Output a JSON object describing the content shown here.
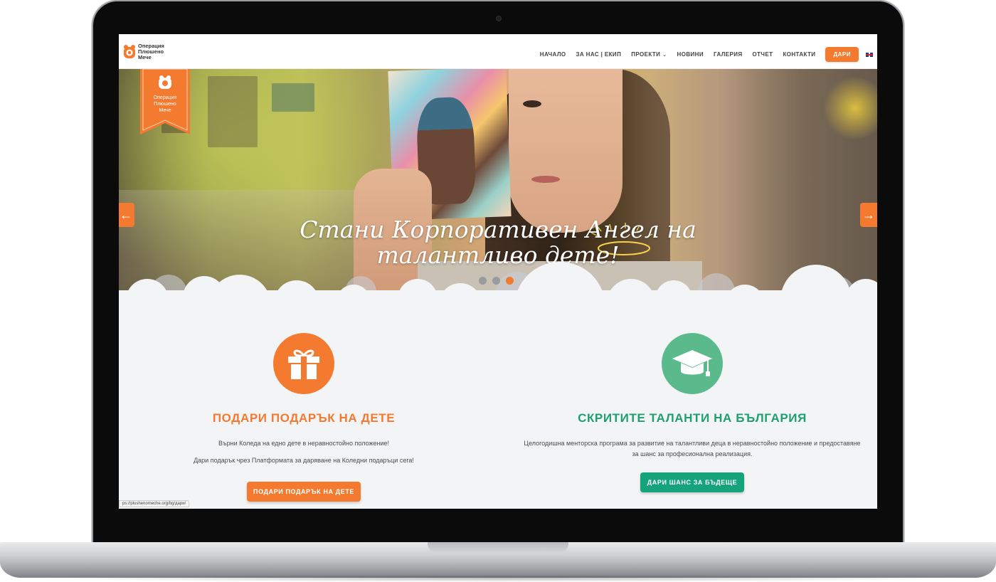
{
  "header": {
    "logo": {
      "line1": "Операция",
      "line2": "Плюшено",
      "line3": "Мече"
    },
    "nav": [
      {
        "label": "НАЧАЛО"
      },
      {
        "label": "ЗА НАС | ЕКИП"
      },
      {
        "label": "ПРОЕКТИ",
        "has_dropdown": true
      },
      {
        "label": "НОВИНИ"
      },
      {
        "label": "ГАЛЕРИЯ"
      },
      {
        "label": "ОТЧЕТ"
      },
      {
        "label": "КОНТАКТИ"
      }
    ],
    "donate_label": "ДАРИ",
    "language_icon": "uk-flag-icon"
  },
  "hero": {
    "title_line1": "Стани Корпоративен Ангел на",
    "title_line2": "талантливо дете!",
    "slides_count": 3,
    "active_slide": 3,
    "ribbon_logo": {
      "line1": "Операция",
      "line2": "Плюшено",
      "line3": "Мече"
    }
  },
  "features": [
    {
      "icon": "gift-icon",
      "title": "ПОДАРИ ПОДАРЪК НА ДЕТЕ",
      "text1": "Върни Коледа на едно дете в неравностойно положение!",
      "text2": "Дари подарък чрез Платформата за даряване на Коледни подаръци сега!",
      "button": "ПОДАРИ ПОДАРЪК НА ДЕТЕ"
    },
    {
      "icon": "graduation-cap-icon",
      "title": "СКРИТИТЕ ТАЛАНТИ НА БЪЛГАРИЯ",
      "text1": "Целогодишна менторска програма за развитие на талантливи деца в неравностойно положение и предоставяне",
      "text2": "за шанс за професионална реализация.",
      "button": "ДАРИ ШАНС ЗА БЪДЕЩЕ"
    }
  ],
  "status_bar": {
    "url": "ps://plushenomeche.org/bg/дари/"
  },
  "colors": {
    "accent_orange": "#f47a30",
    "accent_green": "#14a37a",
    "icon_green": "#5aba8c"
  }
}
